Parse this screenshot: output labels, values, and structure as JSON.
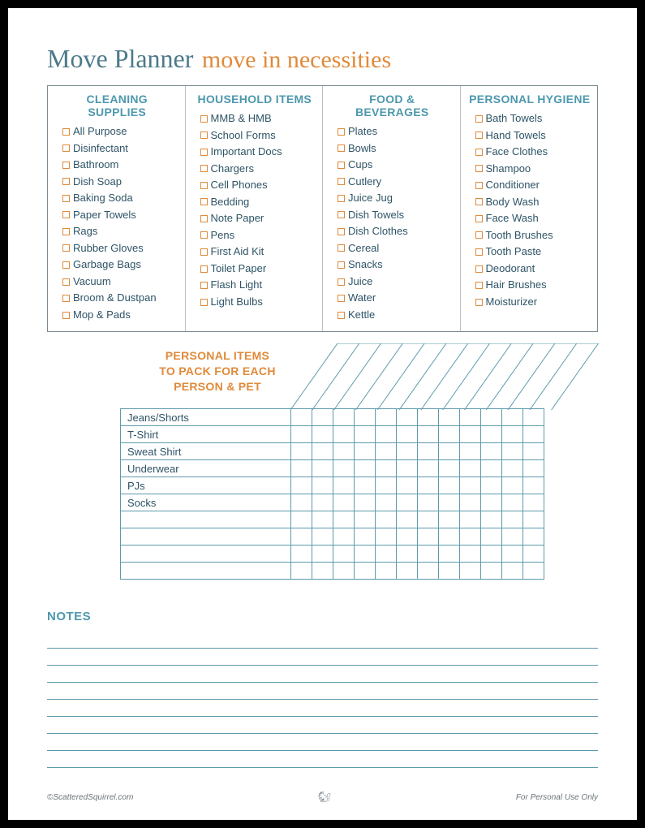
{
  "title": {
    "main": "Move Planner",
    "sub": "move in necessities"
  },
  "columns": [
    {
      "header": "CLEANING SUPPLIES",
      "items": [
        "All Purpose",
        "Disinfectant",
        "Bathroom",
        "Dish Soap",
        "Baking Soda",
        "Paper Towels",
        "Rags",
        "Rubber Gloves",
        "Garbage Bags",
        "Vacuum",
        "Broom & Dustpan",
        "Mop & Pads"
      ]
    },
    {
      "header": "HOUSEHOLD ITEMS",
      "items": [
        "MMB & HMB",
        "School Forms",
        "Important Docs",
        "Chargers",
        "Cell Phones",
        "Bedding",
        "Note Paper",
        "Pens",
        "First Aid Kit",
        "Toilet Paper",
        "Flash Light",
        "Light Bulbs"
      ]
    },
    {
      "header": "FOOD & BEVERAGES",
      "items": [
        "Plates",
        "Bowls",
        "Cups",
        "Cutlery",
        "Juice Jug",
        "Dish Towels",
        "Dish Clothes",
        "Cereal",
        "Snacks",
        "Juice",
        "Water",
        "Kettle"
      ]
    },
    {
      "header": "PERSONAL HYGIENE",
      "items": [
        "Bath Towels",
        "Hand Towels",
        "Face Clothes",
        "Shampoo",
        "Conditioner",
        "Body Wash",
        "Face Wash",
        "Tooth Brushes",
        "Tooth Paste",
        "Deodorant",
        "Hair Brushes",
        "Moisturizer"
      ]
    }
  ],
  "grid": {
    "title_line1": "PERSONAL ITEMS",
    "title_line2": "TO PACK FOR EACH",
    "title_line3": "PERSON & PET",
    "rows": [
      "Jeans/Shorts",
      "T-Shirt",
      "Sweat Shirt",
      "Underwear",
      "PJs",
      "Socks",
      "",
      "",
      "",
      ""
    ],
    "cols": 12
  },
  "notes": {
    "heading": "NOTES",
    "lines": 8
  },
  "footer": {
    "left": "©ScatteredSquirrel.com",
    "right": "For Personal Use Only"
  }
}
